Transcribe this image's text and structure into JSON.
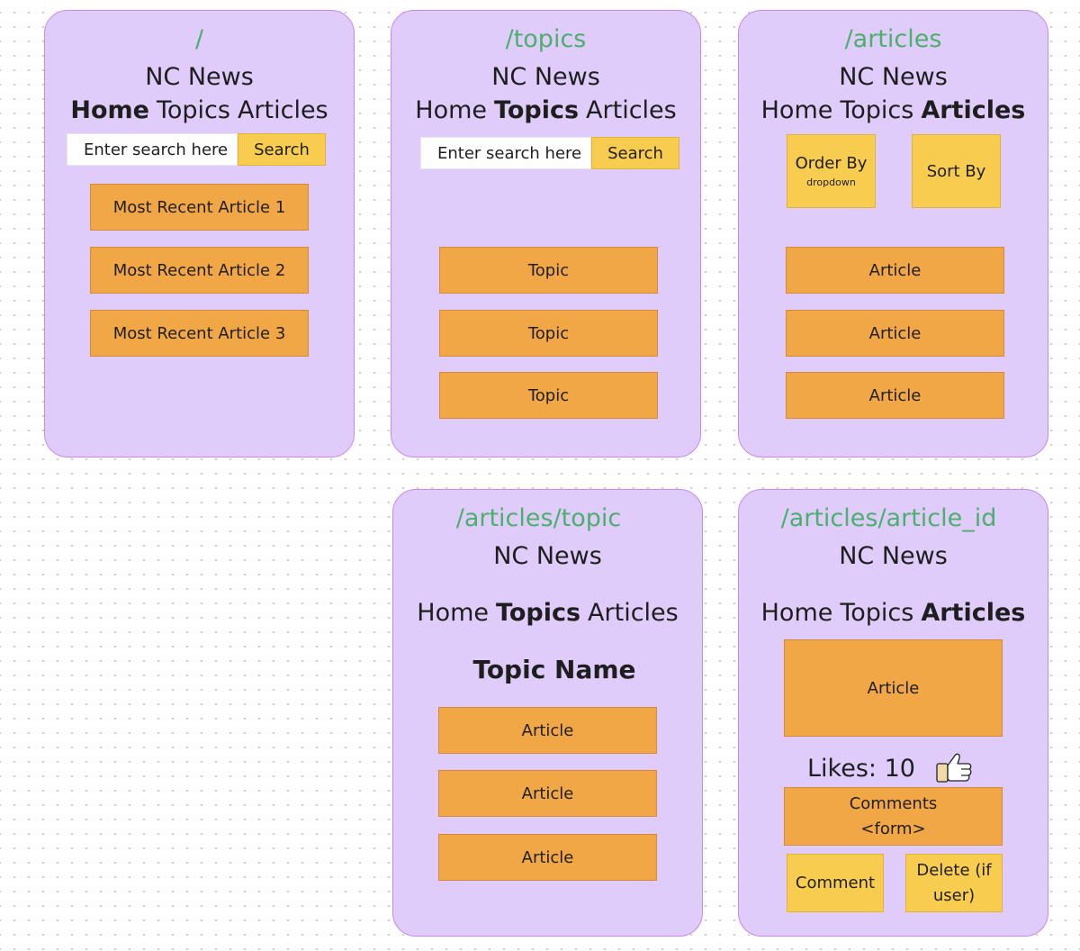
{
  "common": {
    "app_title": "NC News",
    "nav_home": "Home",
    "nav_topics": "Topics",
    "nav_articles": "Articles",
    "search_placeholder": "Enter search here",
    "search_button": "Search"
  },
  "home": {
    "route": "/",
    "articles": [
      "Most Recent Article 1",
      "Most Recent Article 2",
      "Most Recent Article 3"
    ]
  },
  "topics": {
    "route": "/topics",
    "items": [
      "Topic",
      "Topic",
      "Topic"
    ]
  },
  "articles": {
    "route": "/articles",
    "order_by": "Order By",
    "order_by_sub": "dropdown",
    "sort_by": "Sort By",
    "items": [
      "Article",
      "Article",
      "Article"
    ]
  },
  "articles_topic": {
    "route": "/articles/topic",
    "topic_name": "Topic Name",
    "items": [
      "Article",
      "Article",
      "Article"
    ]
  },
  "article_id": {
    "route": "/articles/article_id",
    "article": "Article",
    "likes": "Likes: 10",
    "comments_line1": "Comments",
    "comments_line2": "<form>",
    "comment_button": "Comment",
    "delete_line1": "Delete (if",
    "delete_line2": "user)"
  },
  "colors": {
    "card_bg": "#e0ccfb",
    "card_border": "#c889ec",
    "route_green": "#4caf6c",
    "orange_box": "#f1a745",
    "yellow_box": "#f8cd4f"
  }
}
